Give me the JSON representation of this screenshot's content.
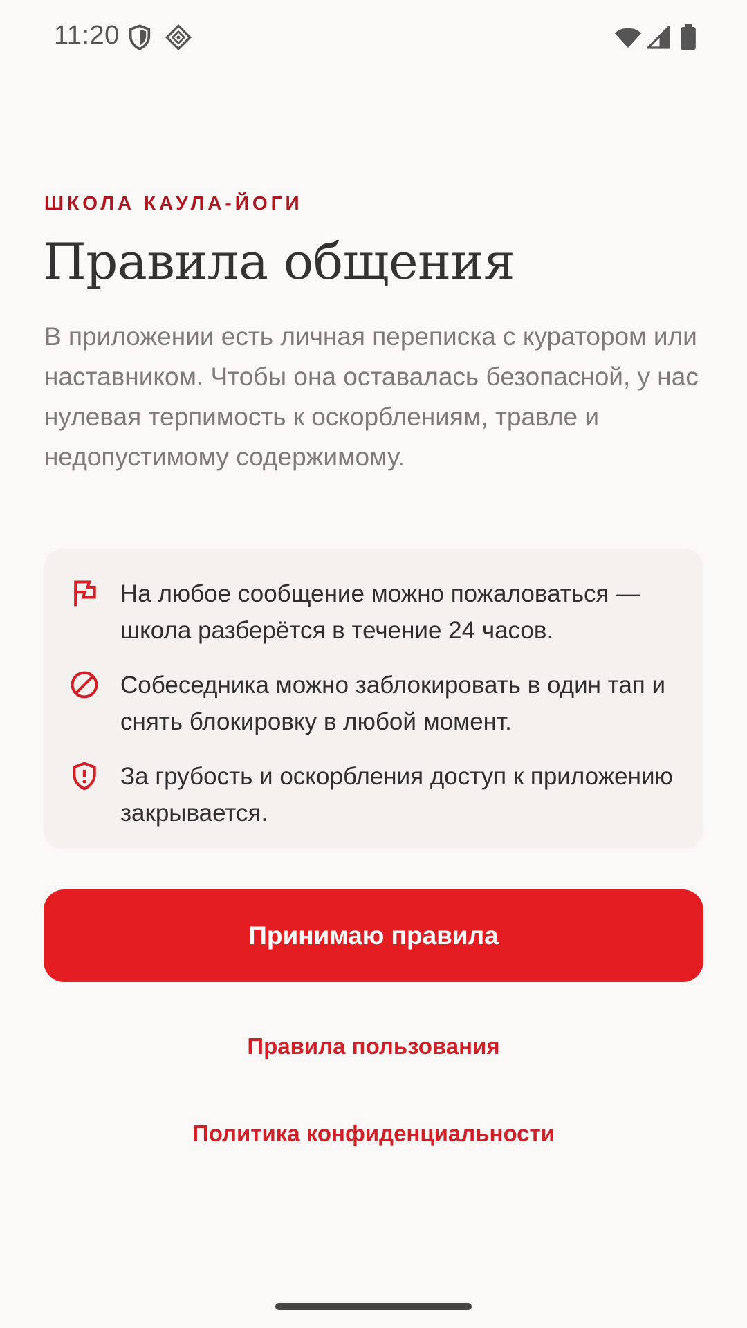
{
  "status_bar": {
    "time": "11:20",
    "left_icons": [
      "shield-icon",
      "location-diamond-icon"
    ],
    "right_icons": [
      "wifi-icon",
      "cellular-signal-icon",
      "battery-icon"
    ]
  },
  "header": {
    "eyebrow": "ШКОЛА КАУЛА-ЙОГИ",
    "title": "Правила общения"
  },
  "intro": "В приложении есть личная переписка с куратором или наставником. Чтобы она оставалась безопасной, у нас нулевая терпимость к оскорблениям, травле и недопустимому содержимому.",
  "rules": [
    {
      "icon": "flag-icon",
      "text": "На любое сообщение можно пожаловаться — школа разберётся в течение 24 часов."
    },
    {
      "icon": "block-icon",
      "text": "Собеседника можно заблокировать в один тап и снять блокировку в любой момент."
    },
    {
      "icon": "shield-alert-icon",
      "text": "За грубость и оскорбления доступ к приложению закрывается."
    }
  ],
  "actions": {
    "accept_label": "Принимаю правила",
    "terms_link": "Правила пользования",
    "privacy_link": "Политика конфиденциальности"
  },
  "colors": {
    "accent": "#e41d23",
    "eyebrow": "#b0161f",
    "background": "#fbf9f8",
    "card": "#f5f1ee",
    "body_text": "#7d7a78"
  }
}
